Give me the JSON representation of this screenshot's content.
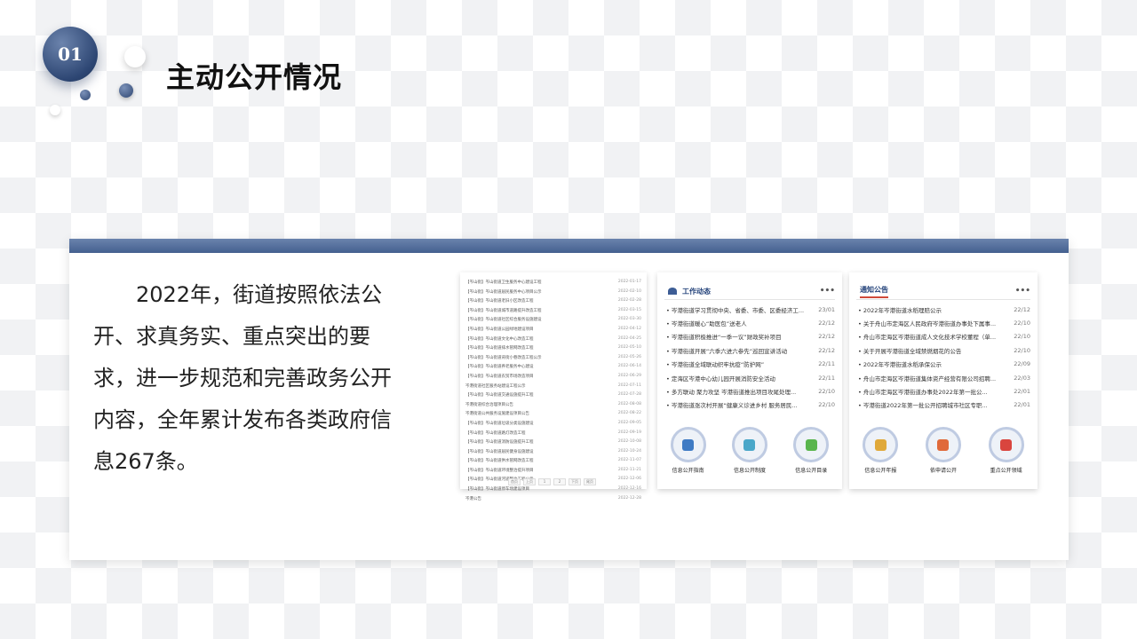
{
  "badge": "01",
  "page_title": "主动公开情况",
  "summary": "2022年，街道按照依法公开、求真务实、重点突出的要求，进一步规范和完善政务公开内容，全年累计发布各类政府信息267条。",
  "panel1": {
    "rows": [
      {
        "title": "【岑山街】岑山街道卫生服务中心建设工程",
        "date": "2022-01-17"
      },
      {
        "title": "【岑山街】岑山街道居民服务中心项目公示",
        "date": "2022-02-10"
      },
      {
        "title": "【岑山街】岑山街道老旧小区改造工程",
        "date": "2022-02-28"
      },
      {
        "title": "【岑山街】岑山街道城市道路提升改造工程",
        "date": "2022-03-15"
      },
      {
        "title": "【岑山街】岑山街道社区综合服务设施建设",
        "date": "2022-03-30"
      },
      {
        "title": "【岑山街】岑山街道公园绿地建设项目",
        "date": "2022-04-12"
      },
      {
        "title": "【岑山街】岑山街道文化中心改造工程",
        "date": "2022-04-25"
      },
      {
        "title": "【岑山街】岑山街道排水管网改造工程",
        "date": "2022-05-10"
      },
      {
        "title": "【岑山街】岑山街道背街小巷改造工程公示",
        "date": "2022-05-26"
      },
      {
        "title": "【岑山街】岑山街道养老服务中心建设",
        "date": "2022-06-14"
      },
      {
        "title": "【岑山街】岑山街道农贸市场改造项目",
        "date": "2022-06-29"
      },
      {
        "title": "岑港街道社区服务站建设工程公示",
        "date": "2022-07-11"
      },
      {
        "title": "【岑山街】岑山街道交通设施提升工程",
        "date": "2022-07-28"
      },
      {
        "title": "岑港街道综合治理项目公告",
        "date": "2022-08-08"
      },
      {
        "title": "岑港街道公共服务设施建设项目公告",
        "date": "2022-08-22"
      },
      {
        "title": "【岑山街】岑山街道垃圾分类设施建设",
        "date": "2022-09-05"
      },
      {
        "title": "【岑山街】岑山街道路灯改造工程",
        "date": "2022-09-19"
      },
      {
        "title": "【岑山街】岑山街道消防设施提升工程",
        "date": "2022-10-08"
      },
      {
        "title": "【岑山街】岑山街道居民健身设施建设",
        "date": "2022-10-24"
      },
      {
        "title": "【岑山街】岑山街道供水管网改造工程",
        "date": "2022-11-07"
      },
      {
        "title": "【岑山街】岑山街道环境整治提升项目",
        "date": "2022-11-21"
      },
      {
        "title": "【岑山街】岑山街道河道整治工程公示",
        "date": "2022-12-06"
      },
      {
        "title": "【岑山街】岑山街道停车场建设项目",
        "date": "2022-12-16"
      },
      {
        "title": "岑港公告",
        "date": "2022-12-28"
      }
    ],
    "pager": [
      "首页",
      "上页",
      "1",
      "2",
      "下页",
      "尾页"
    ]
  },
  "panel2": {
    "heading": "工作动态",
    "more": "•••",
    "rows": [
      {
        "title": "岑港街道学习贯彻中央、省委、市委、区委经济工...",
        "date": "23/01"
      },
      {
        "title": "岑港街道暖心“助医包”送老人",
        "date": "22/12"
      },
      {
        "title": "岑港街道积极推进“一季一议”财政奖补项目",
        "date": "22/12"
      },
      {
        "title": "岑港街道开展“六季六进六参先”巡回宣讲活动",
        "date": "22/12"
      },
      {
        "title": "岑港街道全域联动织牢抗疫“防护网”",
        "date": "22/11"
      },
      {
        "title": "定海区岑港中心幼儿园开展消防安全活动",
        "date": "22/11"
      },
      {
        "title": "多方联动 聚力攻坚 岑港街道推出项目攻尾处理...",
        "date": "22/10"
      },
      {
        "title": "岑港街道涨次村开展“健康义诊进乡村 服务居民...",
        "date": "22/10"
      }
    ],
    "icons": [
      {
        "label": "信息公开指南",
        "color": "#3f7bc4"
      },
      {
        "label": "信息公开制度",
        "color": "#4aa7c9"
      },
      {
        "label": "信息公开目录",
        "color": "#59b54d"
      }
    ]
  },
  "panel3": {
    "heading": "通知公告",
    "more": "•••",
    "rows": [
      {
        "title": "2022年岑港街道水稻理赔公示",
        "date": "22/12"
      },
      {
        "title": "关于舟山市定海区人民政府岑港街道办事处下属事...",
        "date": "22/10"
      },
      {
        "title": "舟山市定海区岑港街道成人文化技术学校董程（单...",
        "date": "22/10"
      },
      {
        "title": "关于开展岑港街道全域禁燃烟花的公告",
        "date": "22/10"
      },
      {
        "title": "2022年岑港街道水稻承保公示",
        "date": "22/09"
      },
      {
        "title": "舟山市定海区岑港街道集体资产经营有限公司招聘...",
        "date": "22/03"
      },
      {
        "title": "舟山市定海区岑港街道办事处2022年第一批公...",
        "date": "22/01"
      },
      {
        "title": "岑港街道2022年第一批公开招聘城市社区专职...",
        "date": "22/01"
      }
    ],
    "icons": [
      {
        "label": "信息公开年报",
        "color": "#e0a93a"
      },
      {
        "label": "依申请公开",
        "color": "#e06a3a"
      },
      {
        "label": "重点公开领域",
        "color": "#d9453e"
      }
    ]
  }
}
